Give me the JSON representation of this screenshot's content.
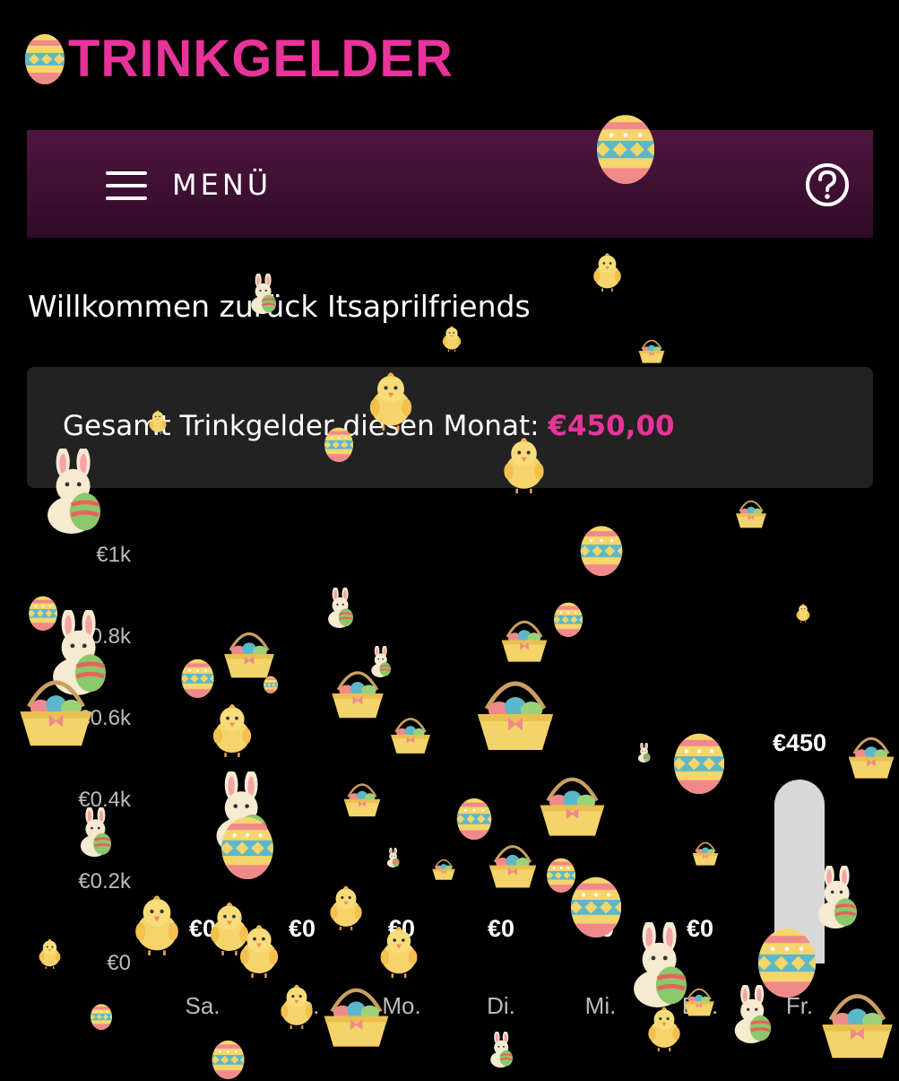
{
  "header": {
    "logo_text": "TRINKGELDER"
  },
  "navbar": {
    "menu_label": "MENÜ",
    "help_icon": "question-circle-icon",
    "menu_icon": "hamburger-icon"
  },
  "welcome": {
    "text": "Willkommen zurück Itsaprilfriends"
  },
  "summary": {
    "label": "Gesamt Trinkgelder diesen Monat: ",
    "amount": "€450,00"
  },
  "colors": {
    "accent": "#e8349a",
    "navbar": "#3e1033",
    "card": "#222222",
    "bar": "#d8d8d8"
  },
  "chart_data": {
    "type": "bar",
    "y_ticks": [
      "€0",
      "€0.2k",
      "€0.4k",
      "€0.6k",
      "€0.8k",
      "€1k"
    ],
    "ylim": [
      0,
      1000
    ],
    "categories": [
      "Sa.",
      "So.",
      "Mo.",
      "Di.",
      "Mi.",
      "Do.",
      "Fr."
    ],
    "values": [
      0,
      0,
      0,
      0,
      0,
      0,
      450
    ],
    "value_labels": [
      "€0",
      "€0",
      "€0",
      "€0",
      "€0",
      "€0",
      "€450"
    ]
  }
}
